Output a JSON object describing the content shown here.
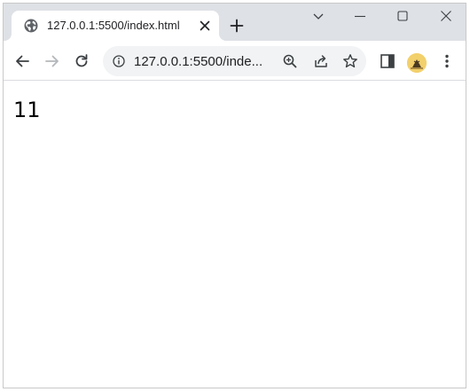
{
  "tab": {
    "title": "127.0.0.1:5500/index.html",
    "favicon": "globe-icon"
  },
  "omnibox": {
    "url": "127.0.0.1:5500/inde...",
    "info_icon": "info-icon"
  },
  "toolbar_icons": [
    "back-arrow-icon",
    "forward-arrow-icon",
    "reload-icon",
    "zoom-icon",
    "share-icon",
    "star-icon",
    "sidebar-icon",
    "profile-avatar",
    "menu-icon"
  ],
  "window_controls": [
    "tab-search-icon",
    "minimize-icon",
    "maximize-icon",
    "close-icon"
  ],
  "page": {
    "text": "11"
  },
  "colors": {
    "titlebar": "#dee1e6",
    "omnibox": "#f1f3f4",
    "avatar": "#f2d06b"
  }
}
